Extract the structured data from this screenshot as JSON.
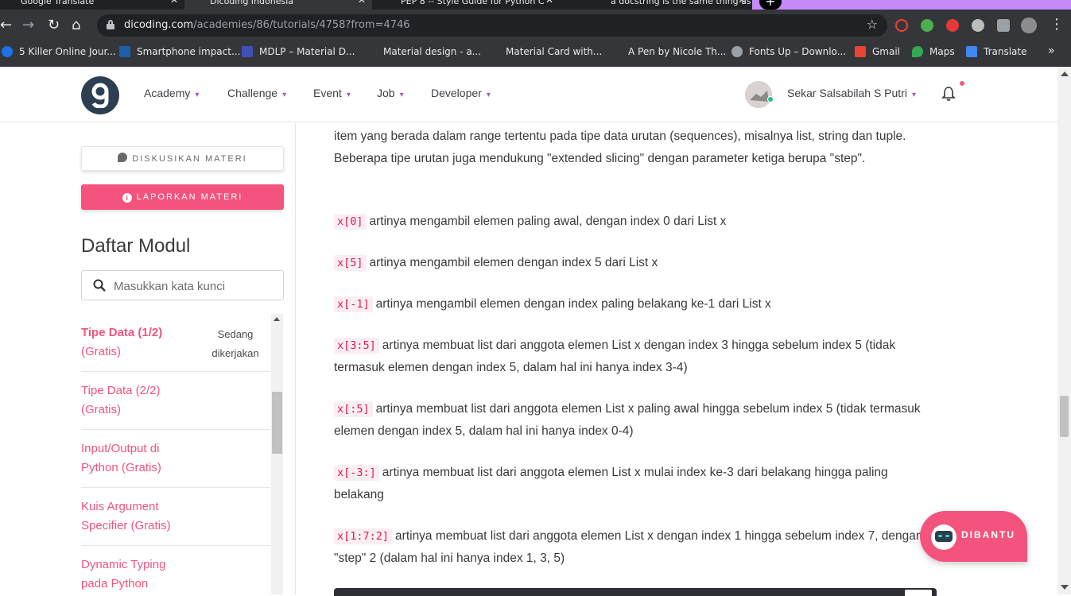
{
  "browser": {
    "tabs": [
      {
        "title": "Google Translate",
        "active": false
      },
      {
        "title": "Dicoding Indonesia",
        "active": true
      },
      {
        "title": "PEP 8 -- Style Guide for Python C",
        "active": false
      },
      {
        "title": "a docstring is the same thing as a",
        "active": false
      }
    ],
    "url_host": "dicoding.com",
    "url_path": "/academies/86/tutorials/4758?from=4746",
    "bookmarks": [
      {
        "label": "5 Killer Online Jour...",
        "color": "#1a73e8"
      },
      {
        "label": "Smartphone impact...",
        "color": "#1d5fa8"
      },
      {
        "label": "MDLP – Material D...",
        "color": "#3f51b5"
      },
      {
        "label": "Material design - a...",
        "color": "#35363a"
      },
      {
        "label": "Material Card with...",
        "color": "#35363a"
      },
      {
        "label": "A Pen by Nicole Th...",
        "color": "#35363a"
      },
      {
        "label": "Fonts Up – Downlo...",
        "color": "#9aa0a6"
      },
      {
        "label": "Gmail",
        "color": "#ea4335"
      },
      {
        "label": "Maps",
        "color": "#34a853"
      },
      {
        "label": "Translate",
        "color": "#4285f4"
      }
    ],
    "more_bookmarks": "»"
  },
  "header": {
    "nav": [
      "Academy",
      "Challenge",
      "Event",
      "Job",
      "Developer"
    ],
    "username": "Sekar Salsabilah S Putri"
  },
  "sidebar": {
    "discuss_label": "DISKUSIKAN MATERI",
    "report_label": "LAPORKAN MATERI",
    "modul_title": "Daftar Modul",
    "search_placeholder": "Masukkan kata kunci",
    "modules": [
      {
        "title": "Tipe Data (1/2)",
        "sub": "(Gratis)",
        "status": "Sedang dikerjakan",
        "active": true
      },
      {
        "title": "Tipe Data (2/2)",
        "sub": "(Gratis)",
        "status": "",
        "active": false
      },
      {
        "title": "Input/Output di",
        "sub": "Python (Gratis)",
        "status": "",
        "active": false
      },
      {
        "title": "Kuis Argument",
        "sub": "Specifier (Gratis)",
        "status": "",
        "active": false
      },
      {
        "title": "Dynamic Typing",
        "sub": "pada Python",
        "status": "",
        "active": false
      }
    ]
  },
  "content": {
    "intro": "item yang berada dalam range tertentu pada tipe data urutan (sequences), misalnya list, string dan tuple. Beberapa tipe urutan juga mendukung \"extended slicing\" dengan parameter ketiga berupa \"step\".",
    "items": [
      {
        "code": "x[0]",
        "text": "artinya mengambil elemen paling awal, dengan index 0 dari List x"
      },
      {
        "code": "x[5]",
        "text": "artinya mengambil elemen dengan index 5 dari List x"
      },
      {
        "code": "x[-1]",
        "text": "artinya mengambil elemen dengan index paling belakang ke-1 dari List x"
      },
      {
        "code": "x[3:5]",
        "text": "artinya membuat list dari anggota elemen List x dengan index 3 hingga sebelum index 5 (tidak termasuk elemen dengan index 5, dalam hal ini hanya index 3-4)"
      },
      {
        "code": "x[:5]",
        "text": "artinya membuat list dari anggota elemen List x paling awal hingga sebelum index 5 (tidak termasuk elemen dengan index 5, dalam hal ini hanya index 0-4)"
      },
      {
        "code": "x[-3:]",
        "text": "artinya membuat list dari anggota elemen List x mulai index ke-3 dari belakang hingga paling belakang"
      },
      {
        "code": "x[1:7:2]",
        "text": "artinya membuat list dari anggota elemen List x dengan index 1 hingga sebelum index 7, dengan \"step\" 2 (dalam hal ini hanya index 1, 3, 5)"
      }
    ]
  },
  "dibantu_label": "DIBANTU",
  "colors": {
    "accent": "#f4537d",
    "brand_dark": "#2d3e50",
    "code": "#e3175c",
    "nav_chevron": "#a259c7"
  }
}
